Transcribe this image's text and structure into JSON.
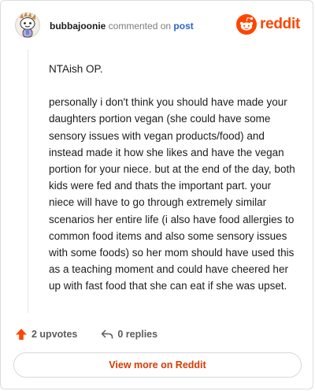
{
  "header": {
    "username": "bubbajoonie",
    "action_text": "commented on",
    "post_link": "post",
    "brand": "reddit",
    "avatar_icon": "snoo-avatar-icon",
    "brand_icon": "reddit-snoo-icon"
  },
  "comment": {
    "paragraph1": "NTAish OP.",
    "paragraph2": "personally i don't think you should have made your daughters portion vegan (she could have some sensory issues with vegan products/food) and instead made it how she likes and have the vegan portion for your niece. but at the end of the day, both kids were fed and thats the important part. your niece will have to go through extremely similar scenarios her entire life (i also have food allergies to common food items and also some sensory issues with some foods) so her mom should have used this as a teaching moment and could have cheered her up with fast food that she can eat if she was upset."
  },
  "actions": {
    "upvotes": "2 upvotes",
    "replies": "0 replies",
    "upvote_icon": "upvote-arrow-icon",
    "reply_icon": "reply-arrow-icon"
  },
  "cta": {
    "label": "View more on Reddit"
  },
  "colors": {
    "brand": "#ff4500",
    "link": "#2b63c8",
    "cta_text": "#d93900",
    "text": "#1c1c1c",
    "muted": "#7c7c7c"
  }
}
